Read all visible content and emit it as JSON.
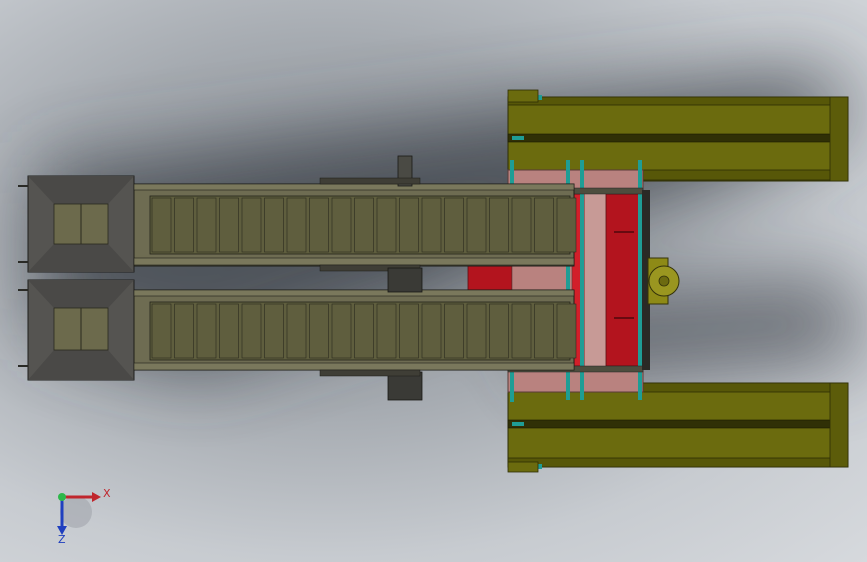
{
  "triad": {
    "x_label": "X",
    "y_label": "Y",
    "z_label": "Z",
    "x_color": "#c0262d",
    "y_color": "#2db84a",
    "z_color": "#1f3fbf"
  },
  "colors": {
    "conveyor_frame": "#6e6c52",
    "conveyor_belt": "#5f5e3e",
    "hopper": "#555451",
    "hopper_pad": "#6c6a4c",
    "rail_olive": "#6b6b0e",
    "red_plate": "#b3141e",
    "pink_panel": "#b9827f",
    "teal": "#1f9d95",
    "gear_yellow": "#8e8a16"
  }
}
